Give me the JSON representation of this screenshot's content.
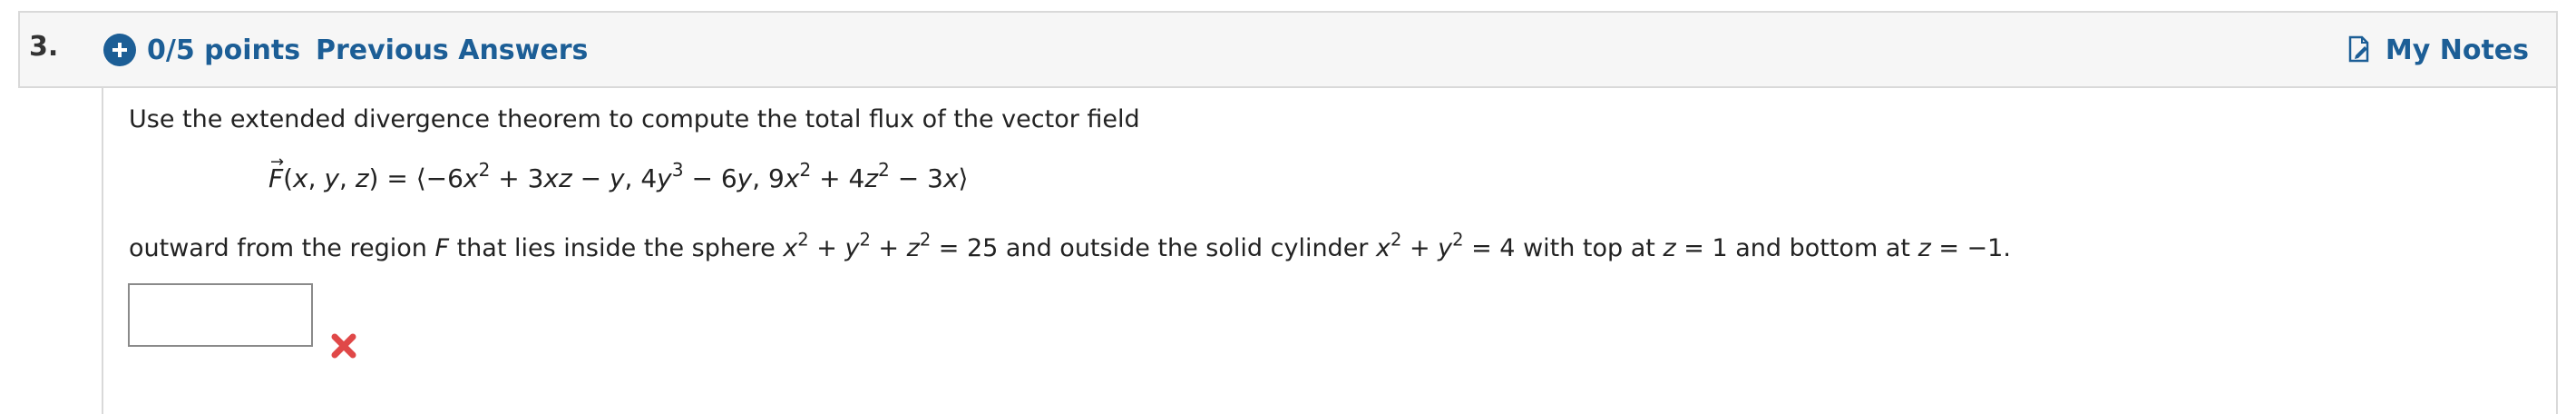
{
  "question": {
    "number": "3.",
    "points": "0/5 points",
    "previous_answers": "Previous Answers",
    "my_notes": "My Notes"
  },
  "problem": {
    "intro": "Use the extended divergence theorem to compute the total flux of the vector field",
    "equation": "F(x, y, z) = ⟨−6x² + 3xz − y, 4y³ − 6y, 9x² + 4z² − 3x⟩",
    "region": "outward from the region F that lies inside the sphere x² + y² + z² = 25 and outside the solid cylinder x² + y² = 4 with top at z = 1 and bottom at z = −1."
  },
  "answer": {
    "value": "",
    "status": "incorrect"
  },
  "colors": {
    "accent": "#1c5e96",
    "incorrect": "#e04848",
    "header_bg": "#f6f6f6",
    "border": "#d9d9d9"
  },
  "icons": {
    "points": "plus-circle-icon",
    "notes": "note-edit-icon",
    "status": "x-mark-icon"
  }
}
